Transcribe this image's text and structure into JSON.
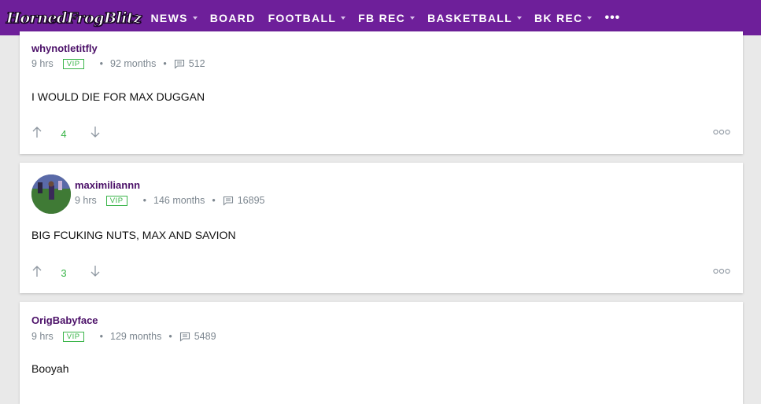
{
  "header": {
    "logo_text": "HornedFrogBlitz",
    "nav": [
      {
        "label": "NEWS",
        "has_caret": true
      },
      {
        "label": "BOARD",
        "has_caret": false
      },
      {
        "label": "FOOTBALL",
        "has_caret": true
      },
      {
        "label": "FB REC",
        "has_caret": true
      },
      {
        "label": "BASKETBALL",
        "has_caret": true
      },
      {
        "label": "BK REC",
        "has_caret": true
      }
    ],
    "more_label": "•••",
    "brand_color": "#6e1f9a"
  },
  "posts": [
    {
      "author": "whynotletitfly",
      "time": "9 hrs",
      "badge": "VIP",
      "tenure": "92 months",
      "post_count": "512",
      "body": "I WOULD DIE FOR MAX DUGGAN",
      "score": "4",
      "has_avatar": false
    },
    {
      "author": "maximiliannn",
      "time": "9 hrs",
      "badge": "VIP",
      "tenure": "146 months",
      "post_count": "16895",
      "body": "BIG FCUKING NUTS, MAX AND SAVION",
      "score": "3",
      "has_avatar": true
    },
    {
      "author": "OrigBabyface",
      "time": "9 hrs",
      "badge": "VIP",
      "tenure": "129 months",
      "post_count": "5489",
      "body": "Booyah",
      "has_avatar": false
    }
  ],
  "icons": {
    "upvote": "arrow-up-icon",
    "downvote": "arrow-down-icon",
    "posts": "message-icon",
    "options": "more-options-icon"
  },
  "colors": {
    "vip_green": "#3bb54a",
    "username_purple": "#4b1068"
  }
}
